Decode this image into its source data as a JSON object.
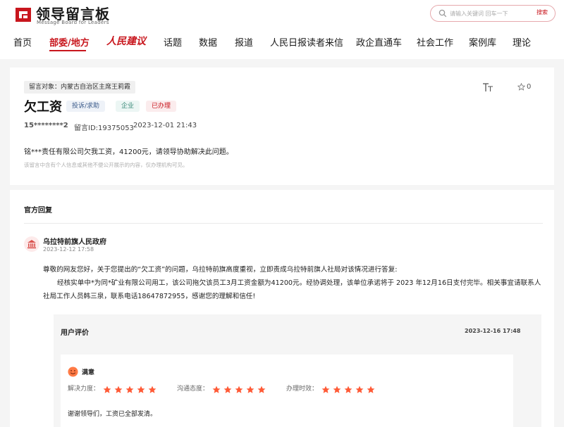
{
  "header": {
    "logo_title": "领导留言板",
    "logo_subtitle": "Message Board for Leaders",
    "search_placeholder": "请输入关键词 回车一下",
    "search_button": "搜索"
  },
  "nav": {
    "items": [
      "首页",
      "部委/地方",
      "人民建议",
      "话题",
      "数据",
      "报道",
      "人民日报读者来信",
      "政企直通车",
      "社会工作",
      "案例库",
      "理论"
    ],
    "active": "部委/地方"
  },
  "message": {
    "target": "留言对象：内蒙古自治区主席王莉霞",
    "title": "欠工资",
    "tags": [
      "投诉/求助",
      "企业",
      "已办理"
    ],
    "user": "15********2",
    "id": "留言ID:19375053",
    "time": "2023-12-01 21:43",
    "favorite_count": "0",
    "content": "铭***责任有限公司欠我工资，41200元，请领导协助解决此问题。",
    "notice": "该留言中含有个人信息或其他不便公开展示的内容，仅办理机构可见。"
  },
  "reply": {
    "section_title": "官方回复",
    "org": "乌拉特前旗人民政府",
    "time": "2023-12-12 17:58",
    "para1": "尊敬的网友您好，关于您提出的“欠工资”的问题，乌拉特前旗高度重视，立即责成乌拉特前旗人社局对该情况进行答复:",
    "para2": "经核实单中*为同*矿业有限公司用工，该公司拖欠该员工3月工资金额为41200元。经协调处理，该单位承诺将于 2023 年12月16日支付完毕。相关事宜请联系人社局工作人员韩三泉，联系电话18647872955，感谢您的理解和信任!"
  },
  "evaluation": {
    "section_title": "用户评价",
    "time": "2023-12-16 17:48",
    "overall": "满意",
    "ratings": [
      {
        "label": "解决力度：",
        "stars": 5
      },
      {
        "label": "沟通态度：",
        "stars": 5
      },
      {
        "label": "办理时效：",
        "stars": 5
      }
    ],
    "comment": "谢谢领导们，工资已全部发清。"
  },
  "colors": {
    "brand_red": "#c8161d",
    "star_orange": "#ff5a36",
    "tag_blue": "#3a5a8a",
    "tag_green": "#3a8a78"
  }
}
